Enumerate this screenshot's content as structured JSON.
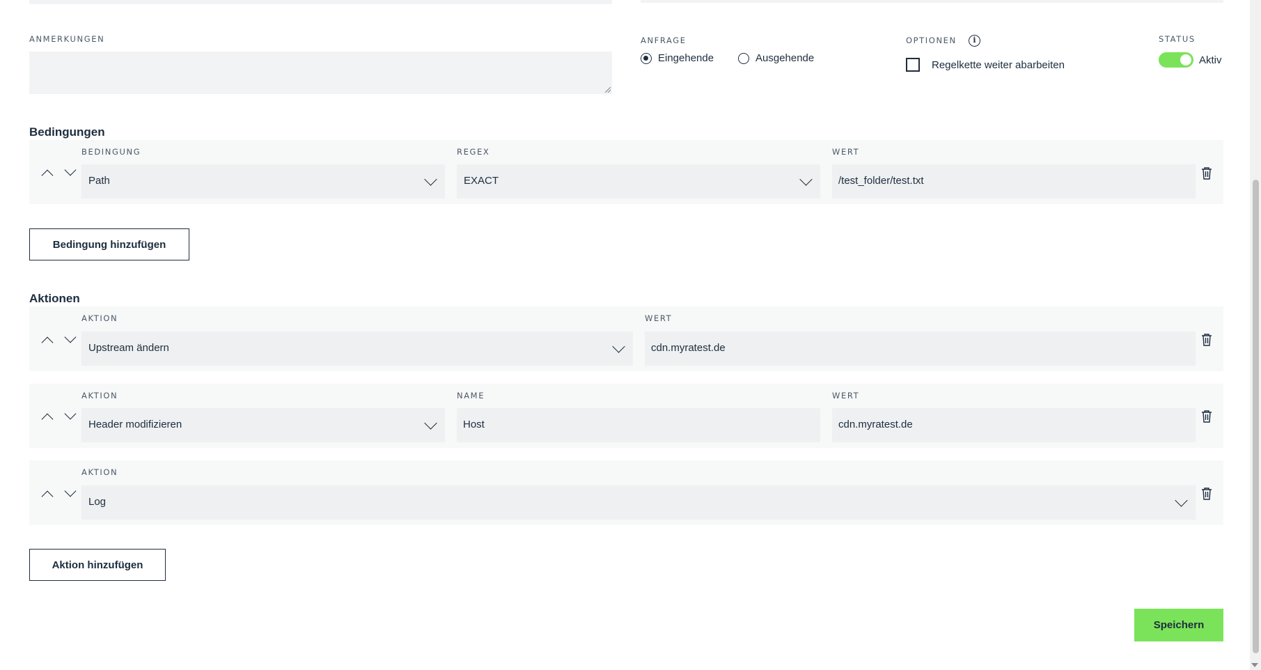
{
  "notes": {
    "label": "ANMERKUNGEN",
    "value": ""
  },
  "request": {
    "label": "ANFRAGE",
    "options": [
      {
        "label": "Eingehende",
        "checked": true
      },
      {
        "label": "Ausgehende",
        "checked": false
      }
    ]
  },
  "options": {
    "label": "OPTIONEN",
    "checkbox_label": "Regelkette weiter abarbeiten",
    "checked": false
  },
  "status": {
    "label": "STATUS",
    "value": "Aktiv",
    "enabled": true
  },
  "conditions": {
    "title": "Bedingungen",
    "headers": {
      "condition": "BEDINGUNG",
      "regex": "REGEX",
      "value": "WERT"
    },
    "rows": [
      {
        "condition": "Path",
        "regex": "EXACT",
        "value": "/test_folder/test.txt"
      }
    ],
    "add_button": "Bedingung hinzufügen"
  },
  "actions": {
    "title": "Aktionen",
    "rows": [
      {
        "action_label": "AKTION",
        "action": "Upstream ändern",
        "value_label": "WERT",
        "value": "cdn.myratest.de"
      },
      {
        "action_label": "AKTION",
        "action": "Header modifizieren",
        "name_label": "NAME",
        "name": "Host",
        "value_label": "WERT",
        "value": "cdn.myratest.de"
      },
      {
        "action_label": "AKTION",
        "action": "Log"
      }
    ],
    "add_button": "Aktion hinzufügen"
  },
  "save_button": "Speichern",
  "colors": {
    "accent": "#7be359",
    "text": "#1d2d3e",
    "field_bg": "#eef0f1"
  }
}
